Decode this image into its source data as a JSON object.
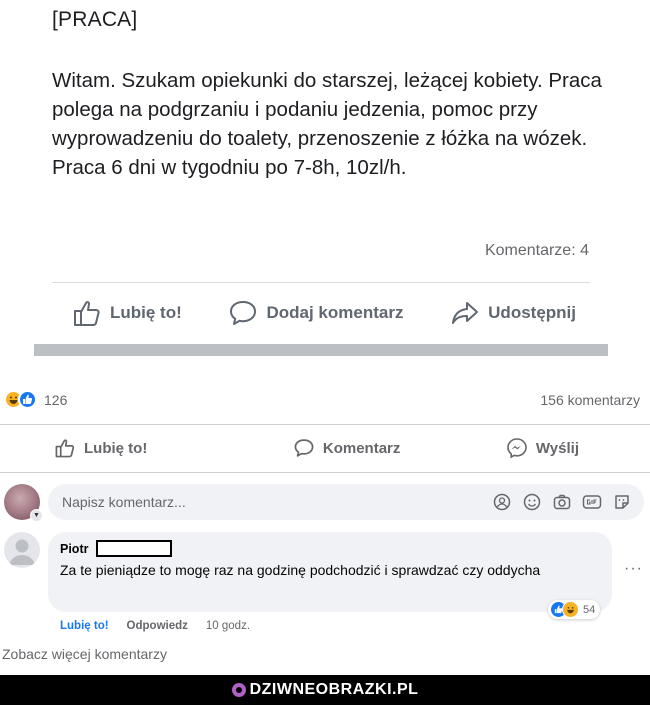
{
  "post_top": {
    "tag": "[PRACA]",
    "body": "Witam. Szukam opiekunki do starszej, leżącej kobiety. Praca polega na podgrzaniu i podaniu jedzenia, pomoc przy wyprowadzeniu do toalety, przenoszenie z łóżka na wózek. Praca 6 dni w tygodniu po 7-8h, 10zl/h.",
    "comments_count": "Komentarze: 4",
    "actions": {
      "like": "Lubię to!",
      "comment": "Dodaj komentarz",
      "share": "Udostępnij"
    }
  },
  "post_bottom": {
    "reactions": {
      "icons": [
        "haha-icon",
        "like-icon"
      ],
      "count": "126"
    },
    "comment_total": "156 komentarzy",
    "actions": {
      "like": "Lubię to!",
      "comment": "Komentarz",
      "send": "Wyślij"
    },
    "composer": {
      "placeholder": "Napisz komentarz...",
      "icons": [
        "avatar-sticker-icon",
        "emoji-icon",
        "camera-icon",
        "gif-icon",
        "sticker-icon"
      ]
    },
    "comment": {
      "author": "Piotr",
      "text": "Za te pieniądze to mogę raz na godzinę podchodzić i sprawdzać czy oddycha",
      "reaction_count": "54",
      "like_label": "Lubię to!",
      "reply_label": "Odpowiedz",
      "time": "10 godz."
    },
    "see_more": "Zobacz więcej komentarzy"
  },
  "watermark": {
    "text": "DZIWNEOBRAZKI.PL"
  },
  "colors": {
    "accent_blue": "#1877f2",
    "haha_yellow": "#f7b125",
    "text_gray": "#65676b",
    "bubble_bg": "#f0f2f5"
  }
}
